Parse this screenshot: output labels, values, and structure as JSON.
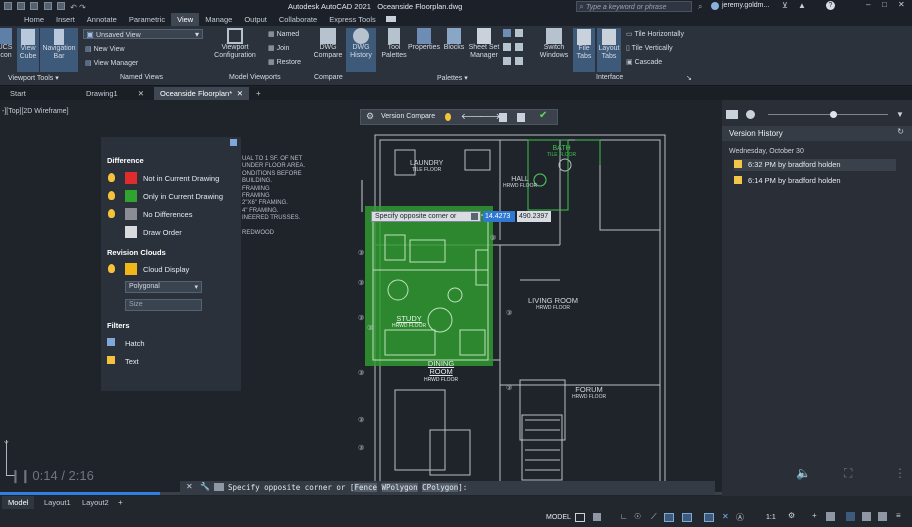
{
  "title_bar": {
    "app": "Autodesk AutoCAD 2021",
    "file": "Oceanside Floorplan.dwg",
    "search_placeholder": "Type a keyword or phrase",
    "user": "jeremy.goldm..."
  },
  "ribbon_tabs": [
    "Home",
    "Insert",
    "Annotate",
    "Parametric",
    "View",
    "Manage",
    "Output",
    "Collaborate",
    "Express Tools"
  ],
  "active_ribbon_tab": "View",
  "ribbon": {
    "viewport_tools": {
      "ucs_label": "UCS\nIcon",
      "view_cube_label": "View\nCube",
      "nav_bar_label": "Navigation\nBar",
      "panel_label": "Viewport Tools"
    },
    "named_views": {
      "dropdown_value": "Unsaved View",
      "new_view": "New View",
      "view_manager": "View Manager",
      "panel_label": "Named Views"
    },
    "model_viewports": {
      "viewport_config": "Viewport\nConfiguration",
      "named": "Named",
      "join": "Join",
      "restore": "Restore",
      "panel_label": "Model Viewports"
    },
    "compare": {
      "dwg_compare": "DWG\nCompare",
      "dwg_history": "DWG\nHistory",
      "panel_label": "Compare"
    },
    "palettes": {
      "tool_palettes": "Tool\nPalettes",
      "properties": "Properties",
      "blocks": "Blocks",
      "sheet_set_manager": "Sheet Set\nManager",
      "panel_label": "Palettes"
    },
    "interface": {
      "switch_windows": "Switch\nWindows",
      "file_tabs": "File\nTabs",
      "layout_tabs": "Layout\nTabs",
      "tile_horizontally": "Tile Horizontally",
      "tile_vertically": "Tile Vertically",
      "cascade": "Cascade",
      "panel_label": "Interface"
    }
  },
  "file_tabs": [
    "Start",
    "Drawing1",
    "Oceanside Floorplan*"
  ],
  "viewport_label": "-][Top][2D Wireframe]",
  "version_compare_toolbar": {
    "label": "Version Compare"
  },
  "compare_panel": {
    "difference_heading": "Difference",
    "difference_items": [
      {
        "label": "Not in Current Drawing",
        "color": "#e02c2c"
      },
      {
        "label": "Only in Current Drawing",
        "color": "#2fa52f"
      },
      {
        "label": "No Differences",
        "color": "#8a8e94"
      },
      {
        "label": "Draw Order",
        "color": "#d8dadd"
      }
    ],
    "revision_clouds_heading": "Revision Clouds",
    "cloud_display": {
      "label": "Cloud Display",
      "color": "#f2b619"
    },
    "cloud_shape": "Polygonal",
    "cloud_size_placeholder": "Size",
    "filters_heading": "Filters",
    "filters": [
      "Hatch",
      "Text"
    ]
  },
  "prompt": {
    "text": "Specify opposite corner or",
    "value_x": "14.4273",
    "value_y": "490.2397"
  },
  "room_labels": {
    "laundry": "LAUNDRY",
    "laundry_sub": "TILE FLOOR",
    "hall": "HALL",
    "hall_sub": "HRWD FLOOR",
    "study": "STUDY",
    "study_sub": "HRWD FLOOR",
    "dining": "DINING\nROOM",
    "dining_sub": "HRWD FLOOR",
    "living": "LIVING ROOM",
    "living_sub": "HRWD FLOOR",
    "forum": "FORUM",
    "forum_sub": "HRWD FLOOR",
    "bath": "BATH",
    "bath_sub": "TILE FLOOR"
  },
  "notes_text": [
    "UAL TO 1 SF. OF NET",
    "UNDER FLOOR AREA.",
    "ONDITIONS BEFORE",
    "BUILDING.",
    "FRAMING",
    "FRAMING",
    "2\"X6\" FRAMING.",
    "4\" FRAMING.",
    "INEERED TRUSSES.",
    "REDWOOD"
  ],
  "version_history": {
    "title": "Version History",
    "date": "Wednesday, October 30",
    "entries": [
      "6:32 PM by bradford holden",
      "6:14 PM by bradford holden"
    ]
  },
  "video_time": "0:14 / 2:16",
  "command_line": {
    "prefix": "Specify opposite corner or [",
    "options": [
      "Fence",
      "WPolygon",
      "CPolygon"
    ],
    "suffix": "]:"
  },
  "layout_tabs": [
    "Model",
    "Layout1",
    "Layout2"
  ],
  "status": {
    "model": "MODEL",
    "scale": "1:1"
  }
}
